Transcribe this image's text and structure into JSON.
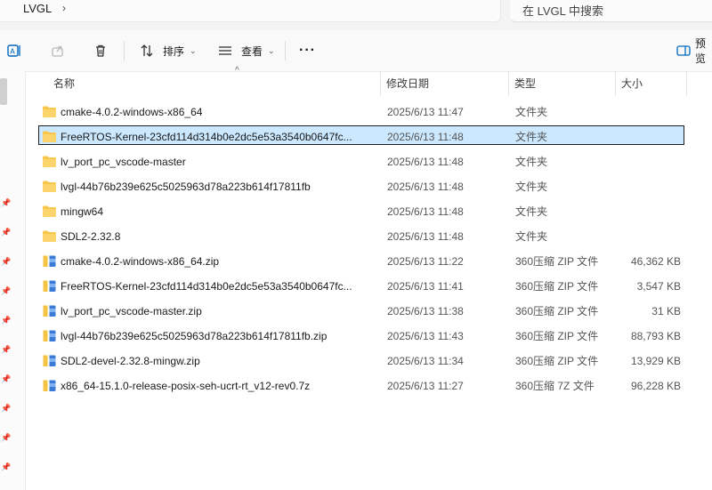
{
  "address": {
    "crumb": "LVGL",
    "chevron": "›"
  },
  "search": {
    "placeholder": "在 LVGL 中搜索"
  },
  "toolbar": {
    "sort_label": "排序",
    "view_label": "查看",
    "more_label": "···",
    "preview_label": "预览"
  },
  "columns": {
    "name": "名称",
    "date": "修改日期",
    "type": "类型",
    "size": "大小"
  },
  "files": [
    {
      "name": "cmake-4.0.2-windows-x86_64",
      "date": "2025/6/13 11:47",
      "type": "文件夹",
      "size": "",
      "icon": "folder-icon"
    },
    {
      "name": "FreeRTOS-Kernel-23cfd114d314b0e2dc5e53a3540b0647fc...",
      "date": "2025/6/13 11:48",
      "type": "文件夹",
      "size": "",
      "icon": "folder-icon",
      "selected": true
    },
    {
      "name": "lv_port_pc_vscode-master",
      "date": "2025/6/13 11:48",
      "type": "文件夹",
      "size": "",
      "icon": "folder-icon"
    },
    {
      "name": "lvgl-44b76b239e625c5025963d78a223b614f17811fb",
      "date": "2025/6/13 11:48",
      "type": "文件夹",
      "size": "",
      "icon": "folder-icon"
    },
    {
      "name": "mingw64",
      "date": "2025/6/13 11:48",
      "type": "文件夹",
      "size": "",
      "icon": "folder-icon"
    },
    {
      "name": "SDL2-2.32.8",
      "date": "2025/6/13 11:48",
      "type": "文件夹",
      "size": "",
      "icon": "folder-icon"
    },
    {
      "name": "cmake-4.0.2-windows-x86_64.zip",
      "date": "2025/6/13 11:22",
      "type": "360压缩 ZIP 文件",
      "size": "46,362 KB",
      "icon": "zip-archive-icon"
    },
    {
      "name": "FreeRTOS-Kernel-23cfd114d314b0e2dc5e53a3540b0647fc...",
      "date": "2025/6/13 11:41",
      "type": "360压缩 ZIP 文件",
      "size": "3,547 KB",
      "icon": "zip-archive-icon"
    },
    {
      "name": "lv_port_pc_vscode-master.zip",
      "date": "2025/6/13 11:38",
      "type": "360压缩 ZIP 文件",
      "size": "31 KB",
      "icon": "zip-archive-icon"
    },
    {
      "name": "lvgl-44b76b239e625c5025963d78a223b614f17811fb.zip",
      "date": "2025/6/13 11:43",
      "type": "360压缩 ZIP 文件",
      "size": "88,793 KB",
      "icon": "zip-archive-icon"
    },
    {
      "name": "SDL2-devel-2.32.8-mingw.zip",
      "date": "2025/6/13 11:34",
      "type": "360压缩 ZIP 文件",
      "size": "13,929 KB",
      "icon": "zip-archive-icon"
    },
    {
      "name": "x86_64-15.1.0-release-posix-seh-ucrt-rt_v12-rev0.7z",
      "date": "2025/6/13 11:27",
      "type": "360压缩 7Z 文件",
      "size": "96,228 KB",
      "icon": "zip-archive-icon"
    }
  ],
  "colors": {
    "selection": "#cce8ff",
    "folder": "#f8c64a",
    "accent": "#0067c0"
  }
}
